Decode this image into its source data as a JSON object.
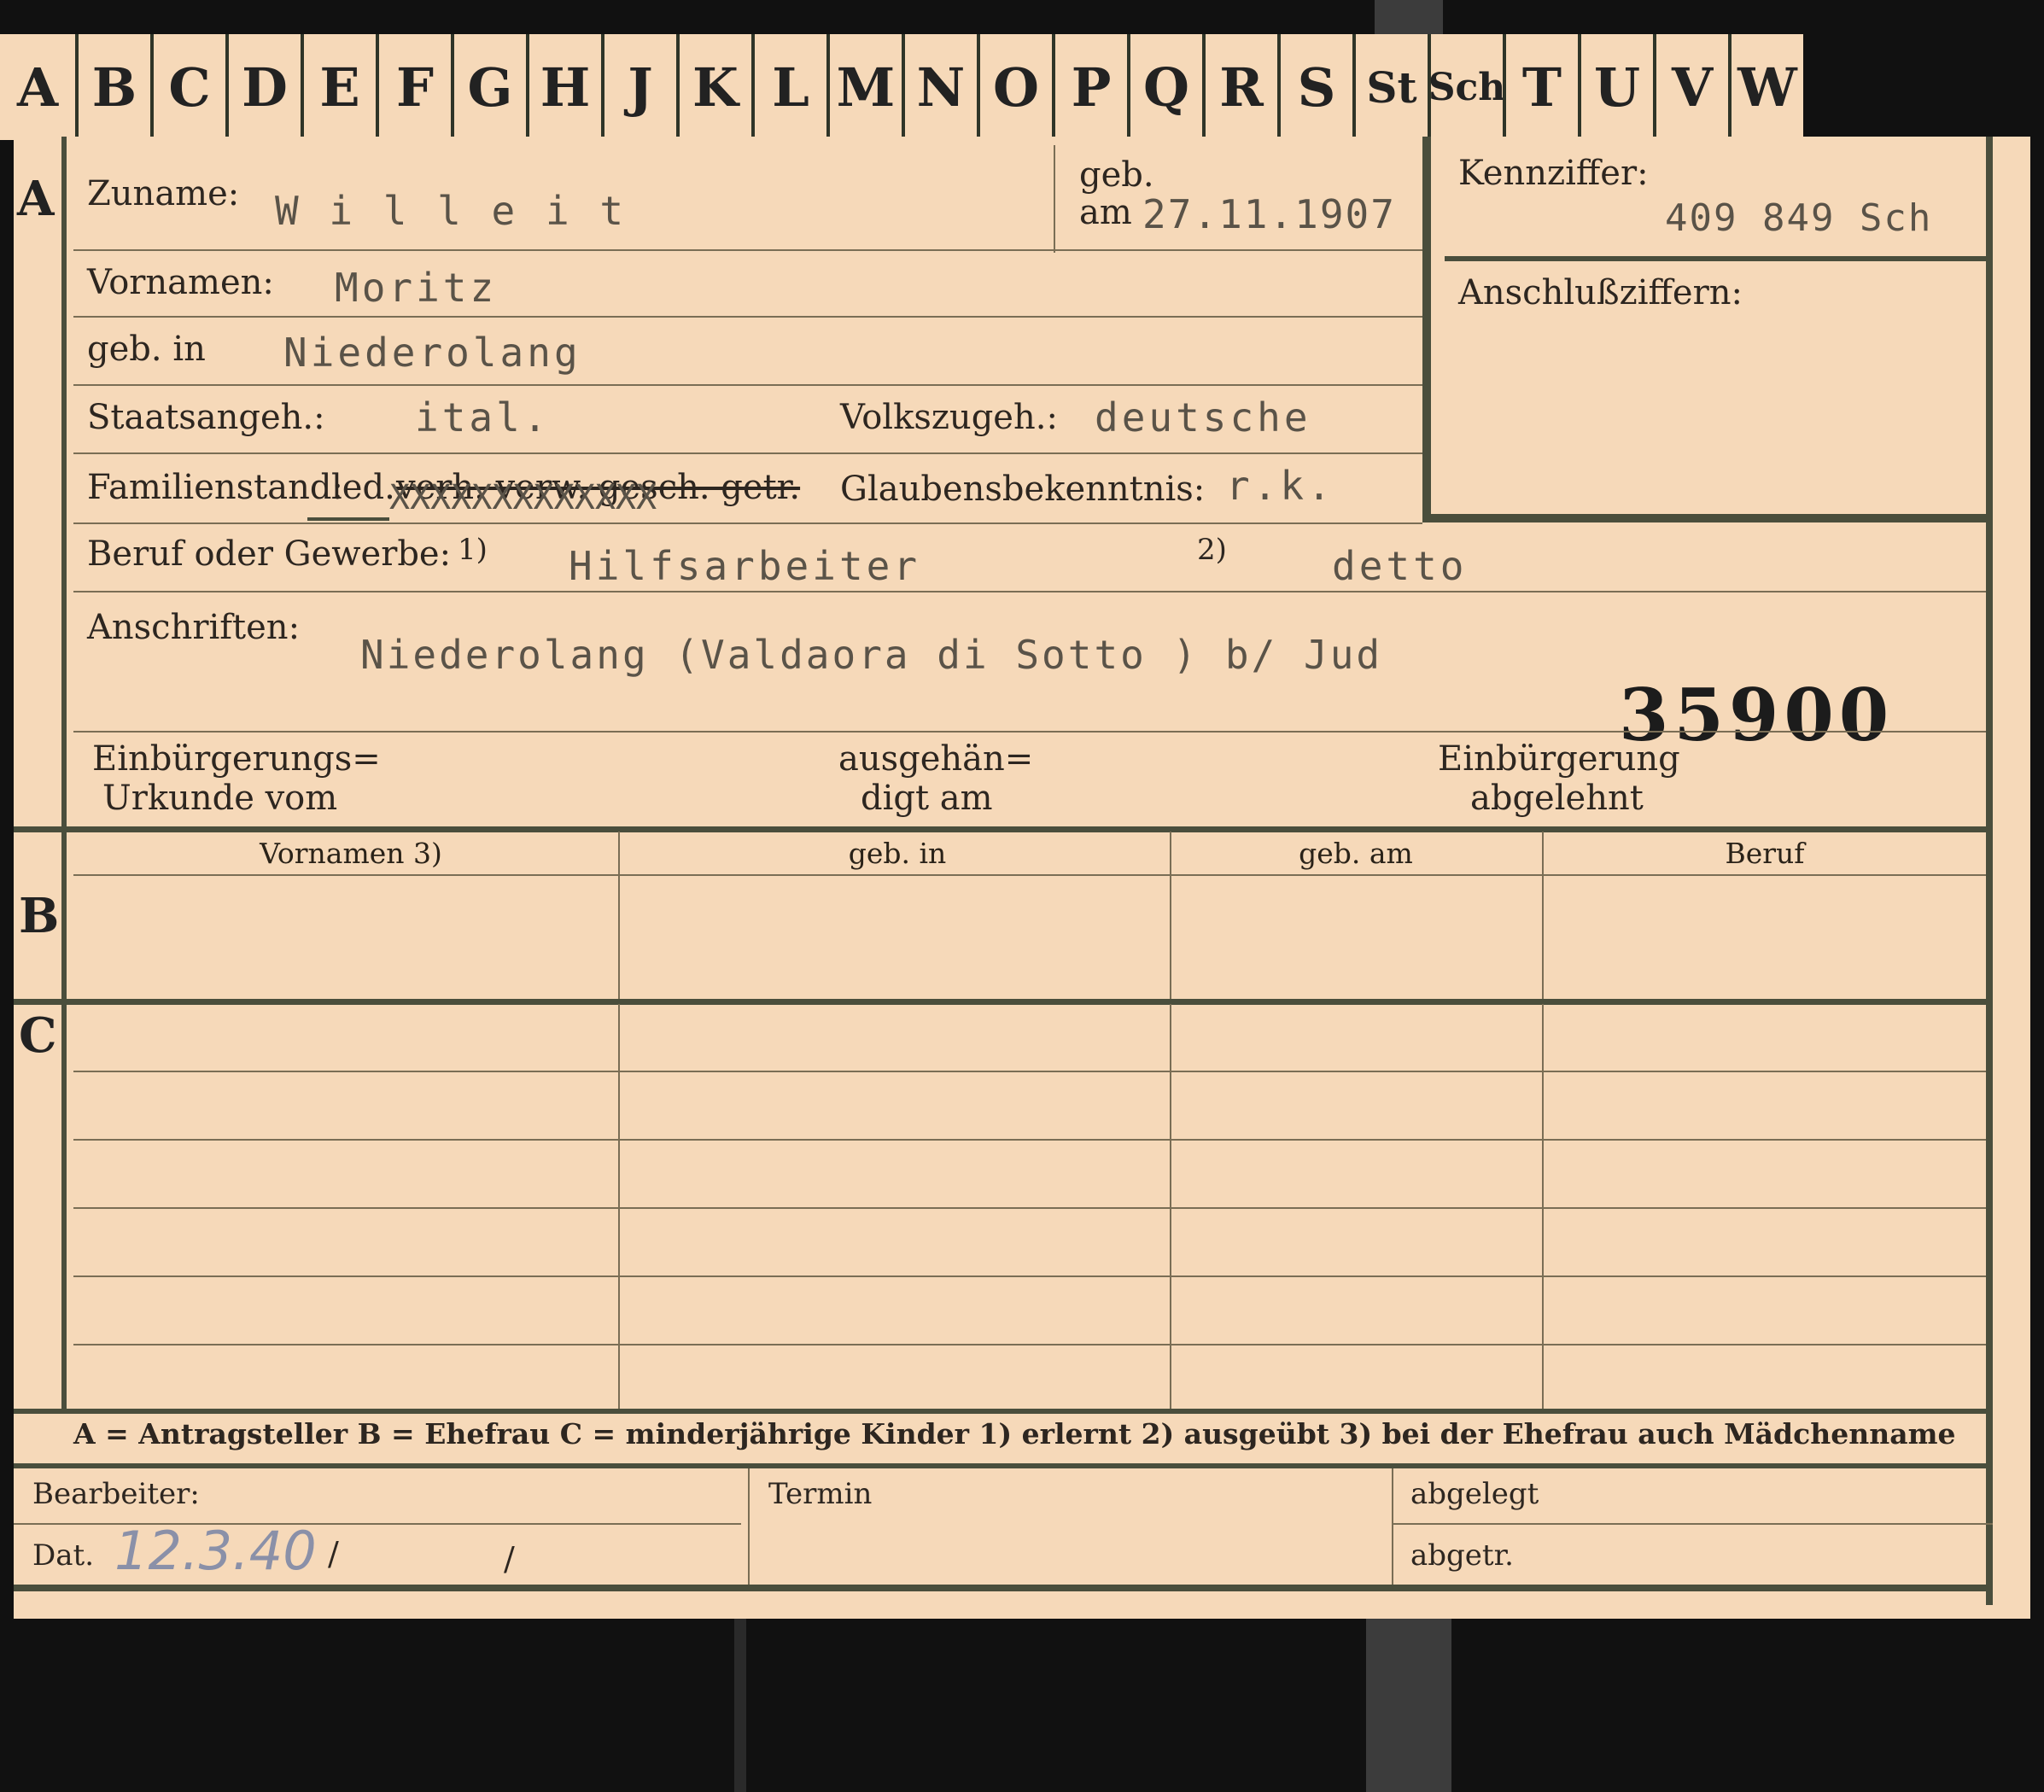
{
  "tabs": [
    "A",
    "B",
    "C",
    "D",
    "E",
    "F",
    "G",
    "H",
    "J",
    "K",
    "L",
    "M",
    "N",
    "O",
    "P",
    "Q",
    "R",
    "S",
    "St",
    "Sch",
    "T",
    "U",
    "V",
    "W"
  ],
  "section_a": {
    "letter": "A",
    "zuname_label": "Zuname:",
    "zuname_value": "W i l l e i t",
    "geb_label": "geb.",
    "am_label": "am",
    "birth_date": "27.11.1907",
    "kennziffer_label": "Kennziffer:",
    "kennziffer_value": "409 849   Sch",
    "anschluss_label": "Anschlußziffern:",
    "vornamen_label": "Vornamen:",
    "vornamen_value": "Moritz",
    "geb_in_label": "geb. in",
    "geb_in_value": "Niederolang",
    "staats_label": "Staatsangeh.:",
    "staats_value": "ital.",
    "volks_label": "Volkszugeh.:",
    "volks_value": "deutsche",
    "familien_label": "Familienstand:",
    "familien_led": "led.",
    "familien_crossed": "verh. verw. gesch. getr.",
    "familien_x": "XXXXXXXXXXXXX",
    "glauben_label": "Glaubensbekenntnis:",
    "glauben_value": "r.k.",
    "beruf_label": "Beruf oder Gewerbe:",
    "beruf_fn1": "1)",
    "beruf_value1": "Hilfsarbeiter",
    "beruf_fn2": "2)",
    "beruf_value2": "detto",
    "anschriften_label": "Anschriften:",
    "anschriften_value": "Niederolang  (Valdaora di Sotto ) b/ Jud",
    "stamp_number": "35900",
    "einb_urkunde_1": "Einbürgerungs=",
    "einb_urkunde_2": "Urkunde vom",
    "ausgeh_1": "ausgehän=",
    "ausgeh_2": "digt am",
    "einb_abg_1": "Einbürgerung",
    "einb_abg_2": "abgelehnt"
  },
  "section_b": {
    "letter": "B",
    "columns": [
      "Vornamen 3)",
      "geb. in",
      "geb. am",
      "Beruf"
    ]
  },
  "section_c": {
    "letter": "C"
  },
  "legend": "A = Antragsteller   B = Ehefrau   C = minderjährige Kinder   1) erlernt   2) ausgeübt   3) bei der Ehefrau auch Mädchenname",
  "footer": {
    "bearbeiter_label": "Bearbeiter:",
    "dat_label": "Dat.",
    "dat_value": "12.3.40",
    "dat_slash1": "/",
    "dat_slash2": "/",
    "termin_label": "Termin",
    "abgelegt_label": "abgelegt",
    "abgetr_label": "abgetr."
  },
  "colors": {
    "card": "#f6d9b9",
    "border": "#4a4e3c",
    "ink": "#2d2620",
    "typed": "#5a5348"
  }
}
